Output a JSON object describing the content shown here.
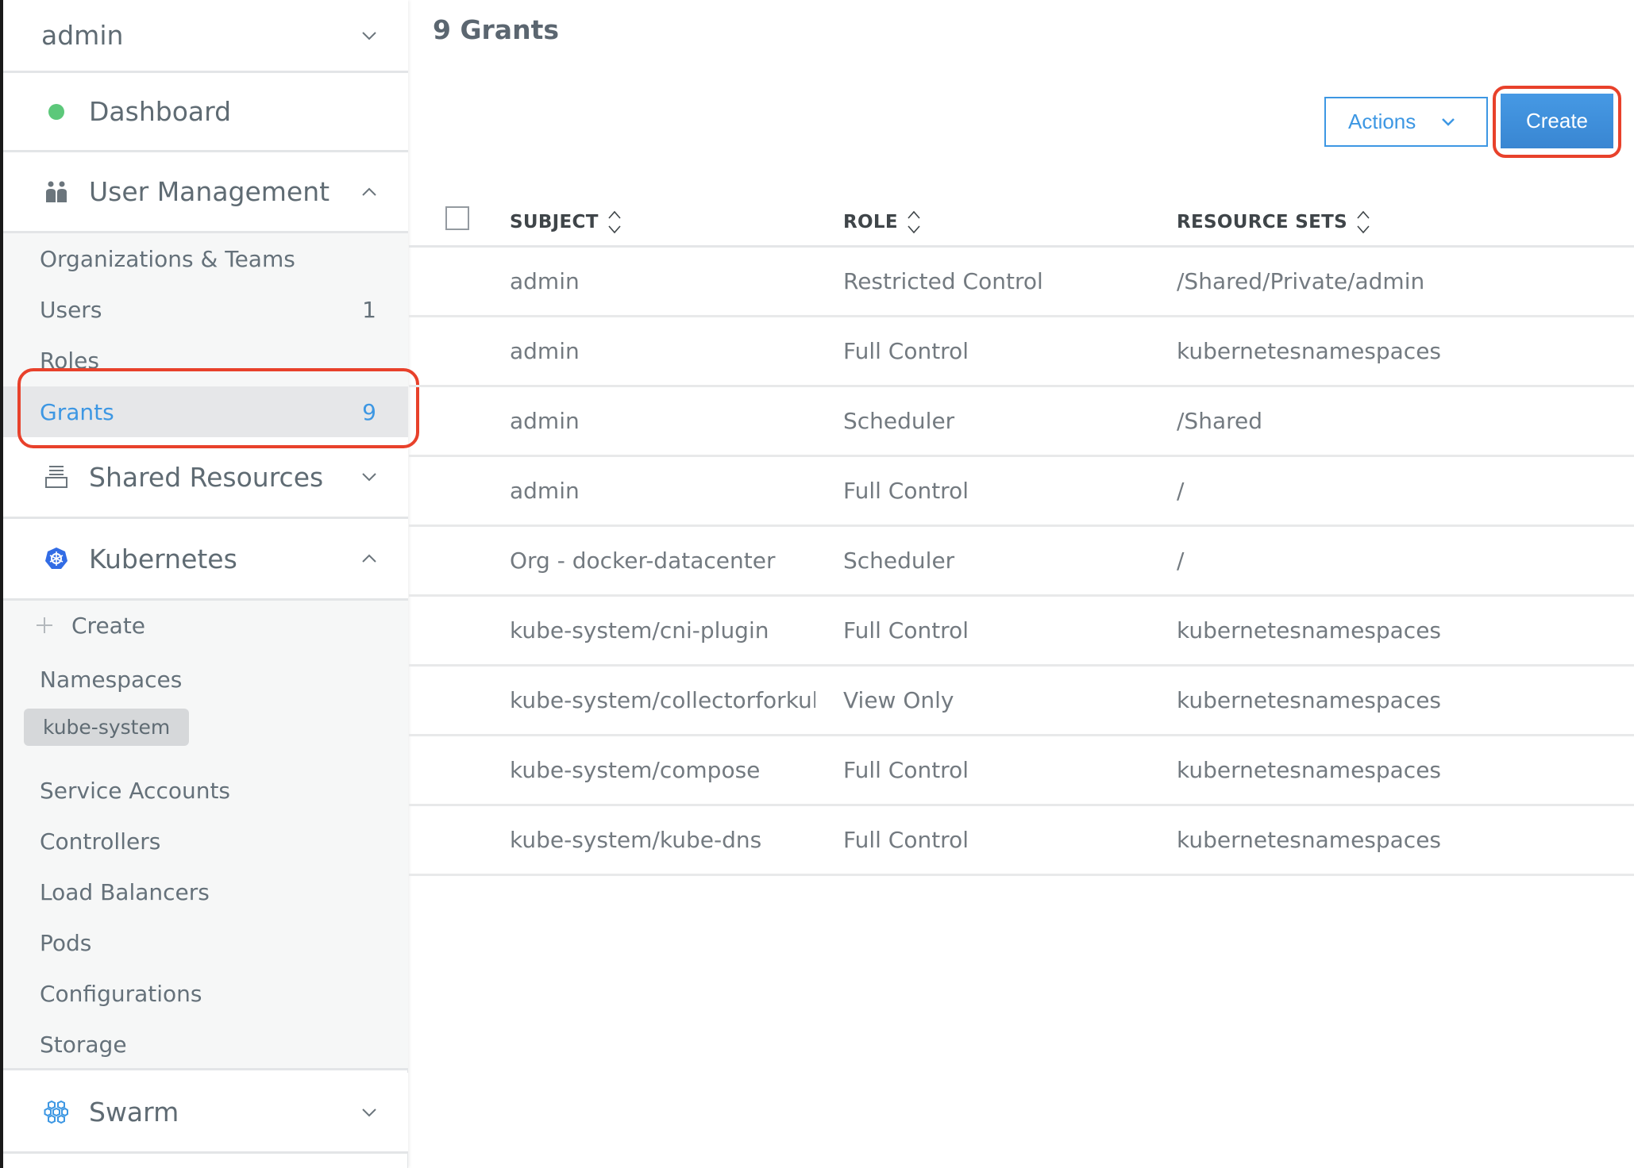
{
  "sidebar": {
    "user": "admin",
    "dashboard": {
      "label": "Dashboard",
      "status_color": "#5cc87a"
    },
    "user_management": {
      "label": "User Management",
      "expanded": true,
      "items": [
        {
          "label": "Organizations & Teams",
          "count": ""
        },
        {
          "label": "Users",
          "count": "1"
        },
        {
          "label": "Roles",
          "count": ""
        },
        {
          "label": "Grants",
          "count": "9",
          "active": true
        }
      ]
    },
    "shared_resources": {
      "label": "Shared Resources",
      "expanded": false
    },
    "kubernetes": {
      "label": "Kubernetes",
      "expanded": true,
      "create_label": "Create",
      "namespaces_label": "Namespaces",
      "namespace_chip": "kube-system",
      "items": [
        {
          "label": "Service Accounts"
        },
        {
          "label": "Controllers"
        },
        {
          "label": "Load Balancers"
        },
        {
          "label": "Pods"
        },
        {
          "label": "Configurations"
        },
        {
          "label": "Storage"
        }
      ]
    },
    "swarm": {
      "label": "Swarm",
      "expanded": false
    }
  },
  "main": {
    "title": "9 Grants",
    "actions_label": "Actions",
    "create_label": "Create",
    "columns": [
      "SUBJECT",
      "ROLE",
      "RESOURCE SETS"
    ],
    "rows": [
      {
        "subject": "admin",
        "role": "Restricted Control",
        "resource_set": "/Shared/Private/admin"
      },
      {
        "subject": "admin",
        "role": "Full Control",
        "resource_set": "kubernetesnamespaces"
      },
      {
        "subject": "admin",
        "role": "Scheduler",
        "resource_set": "/Shared"
      },
      {
        "subject": "admin",
        "role": "Full Control",
        "resource_set": "/"
      },
      {
        "subject": "Org - docker-datacenter",
        "role": "Scheduler",
        "resource_set": "/"
      },
      {
        "subject": "kube-system/cni-plugin",
        "role": "Full Control",
        "resource_set": "kubernetesnamespaces"
      },
      {
        "subject": "kube-system/collectorforkube",
        "role": "View Only",
        "resource_set": "kubernetesnamespaces"
      },
      {
        "subject": "kube-system/compose",
        "role": "Full Control",
        "resource_set": "kubernetesnamespaces"
      },
      {
        "subject": "kube-system/kube-dns",
        "role": "Full Control",
        "resource_set": "kubernetesnamespaces"
      }
    ]
  },
  "colors": {
    "accent": "#3d97e3",
    "annotation": "#e8412b",
    "kubernetes_blue": "#326ce5",
    "swarm_blue": "#3d97e3"
  }
}
